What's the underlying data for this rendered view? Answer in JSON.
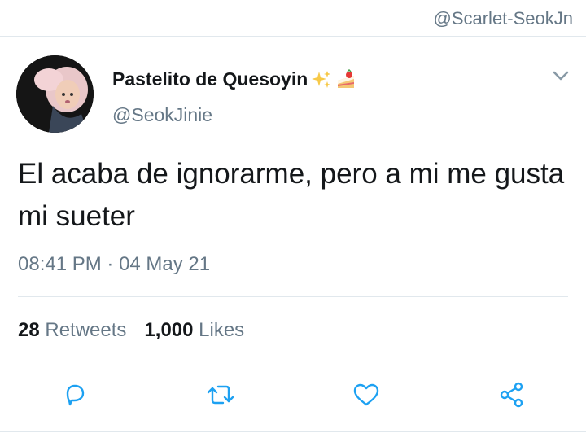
{
  "watermark": "@Scarlet-SeokJn",
  "tweet": {
    "display_name": "Pastelito de Quesoyin",
    "name_emojis": [
      "sparkles-icon",
      "strawberry-cake-icon"
    ],
    "handle": "@SeokJinie",
    "text": "El acaba de ignorarme, pero a mi me gusta mi sueter",
    "time": "08:41 PM",
    "separator": " · ",
    "date": "04 May 21",
    "retweets": {
      "count": "28",
      "label": " Retweets"
    },
    "likes": {
      "count": "1,000",
      "label": " Likes"
    }
  },
  "actions": [
    "reply-icon",
    "retweet-icon",
    "like-icon",
    "share-icon"
  ],
  "colors": {
    "text": "#14171a",
    "muted": "#657786",
    "divider": "#e1e8ed",
    "icon": "#1da1f2"
  }
}
